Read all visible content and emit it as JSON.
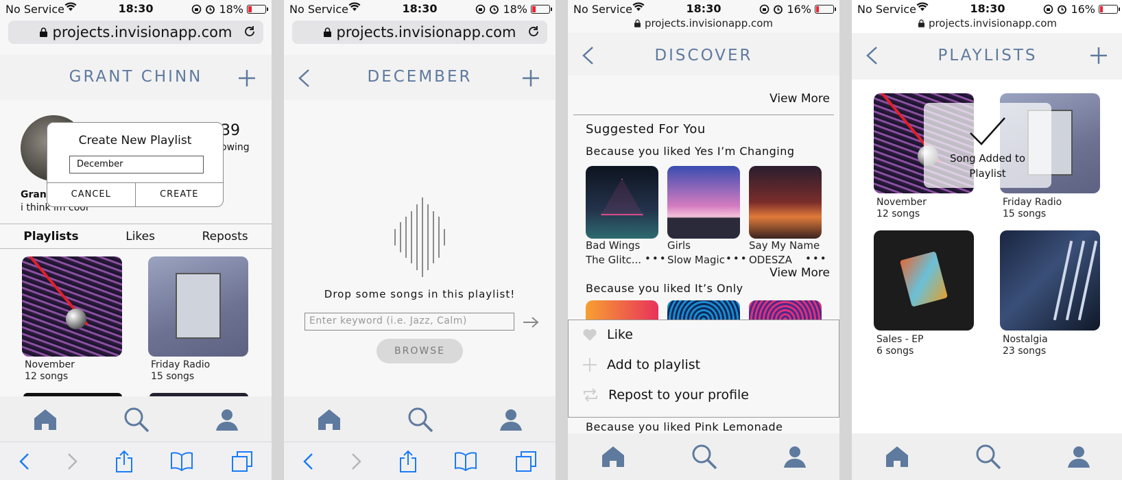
{
  "status": [
    {
      "carrier": "No Service",
      "time": "18:30",
      "battery": "18%",
      "battery_level": 0.18
    },
    {
      "carrier": "No Service",
      "time": "18:30",
      "battery": "18%",
      "battery_level": 0.18
    },
    {
      "carrier": "No Service",
      "time": "18:30",
      "battery": "16%",
      "battery_level": 0.16
    },
    {
      "carrier": "No Service",
      "time": "18:30",
      "battery": "16%",
      "battery_level": 0.16
    }
  ],
  "url": "projects.invisionapp.com",
  "profile": {
    "title": "GRANT CHINN",
    "stat_value": "39",
    "stat_label": "owing",
    "name": "Grant",
    "bio": "i think im cool",
    "tabs": [
      "Playlists",
      "Likes",
      "Reposts"
    ],
    "dialog": {
      "title": "Create New Playlist",
      "input_value": "December",
      "cancel": "CANCEL",
      "create": "CREATE"
    },
    "playlists": [
      {
        "name": "November",
        "count": "12 songs"
      },
      {
        "name": "Friday Radio",
        "count": "15 songs"
      }
    ]
  },
  "december": {
    "title": "DECEMBER",
    "empty_text": "Drop some songs in this playlist!",
    "search_placeholder": "Enter keyword (i.e. Jazz, Calm)",
    "browse": "BROWSE"
  },
  "discover": {
    "title": "DISCOVER",
    "view_more": "View More",
    "suggested": "Suggested For You",
    "because1": "Because you liked Yes I’m Changing",
    "songs": [
      {
        "title": "Bad Wings",
        "artist": "The Glitc..."
      },
      {
        "title": "Girls",
        "artist": "Slow Magic"
      },
      {
        "title": "Say My Name",
        "artist": "ODESZA"
      }
    ],
    "because2": "Because you liked It’s Only",
    "because3": "Because you liked Pink Lemonade",
    "menu": [
      "Like",
      "Add to playlist",
      "Repost to your profile"
    ]
  },
  "playlists_screen": {
    "title": "PLAYLISTS",
    "toast": "Song Added to Playlist",
    "items": [
      {
        "name": "November",
        "count": "12 songs"
      },
      {
        "name": "Friday Radio",
        "count": "15 songs"
      },
      {
        "name": "Sales - EP",
        "count": "6 songs"
      },
      {
        "name": "Nostalgia",
        "count": "23 songs"
      }
    ]
  },
  "colors": {
    "accent": "#5e7a9e",
    "safari_blue": "#1a7bf5"
  }
}
